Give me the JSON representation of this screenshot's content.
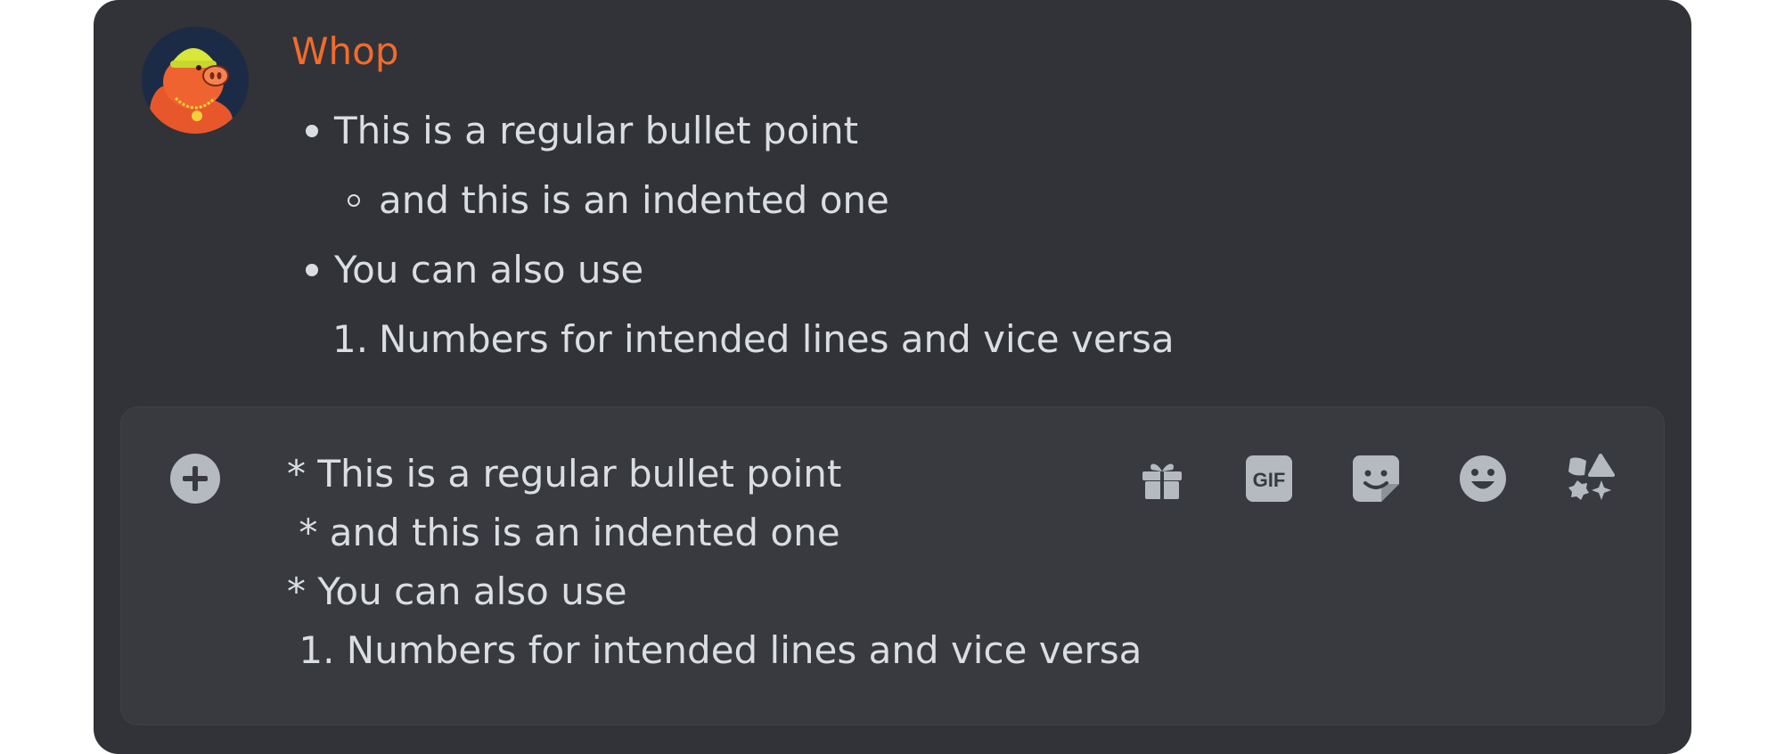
{
  "message": {
    "author": "Whop",
    "author_color": "#f26b2b",
    "lines": [
      {
        "text": "This is a regular bullet point"
      },
      {
        "text": "and this is an indented one"
      },
      {
        "text": "You can also use"
      },
      {
        "marker": "1.",
        "text": "Numbers for intended lines and vice versa"
      }
    ]
  },
  "composer": {
    "text": "* This is a regular bullet point\n * and this is an indented one\n* You can also use\n 1. Numbers for intended lines and vice versa",
    "icons": [
      "add-circle-icon",
      "gift-icon",
      "gif-icon",
      "sticker-icon",
      "emoji-icon",
      "apps-icon"
    ],
    "gif_label": "GIF"
  },
  "colors": {
    "background": "#313338",
    "composer": "#383a40",
    "text": "#dbdee1",
    "icon": "#b5bac1"
  }
}
